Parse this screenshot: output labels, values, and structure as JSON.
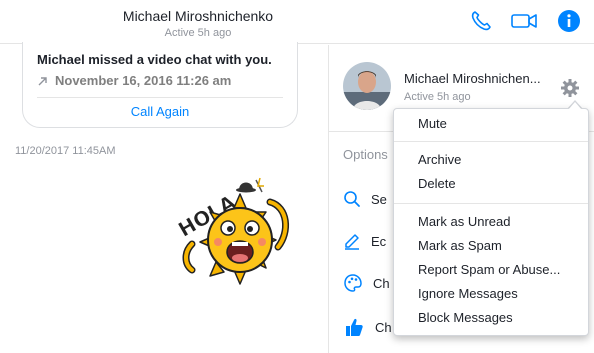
{
  "header": {
    "name": "Michael Miroshnichenko",
    "status": "Active 5h ago",
    "icons": [
      "phone-icon",
      "video-camera-icon",
      "info-icon"
    ],
    "accent": "#0084ff"
  },
  "call_card": {
    "title": "Michael missed a video chat with you.",
    "date": "November 16, 2016 11:26 am",
    "action": "Call Again"
  },
  "timestamp": "11/20/2017 11:45AM",
  "sticker": {
    "text": "HOLA"
  },
  "profile": {
    "name": "Michael Miroshnichen...",
    "status": "Active 5h ago"
  },
  "options": {
    "label": "Options",
    "rows": [
      {
        "icon": "search-icon",
        "text": "Se"
      },
      {
        "icon": "pencil-icon",
        "text": "Ec"
      },
      {
        "icon": "palette-icon",
        "text": "Ch"
      },
      {
        "icon": "thumbs-up-icon",
        "text": "Ch"
      }
    ]
  },
  "menu": {
    "items": [
      "Mute",
      "Archive",
      "Delete",
      "Mark as Unread",
      "Mark as Spam",
      "Report Spam or Abuse...",
      "Ignore Messages",
      "Block Messages"
    ]
  }
}
